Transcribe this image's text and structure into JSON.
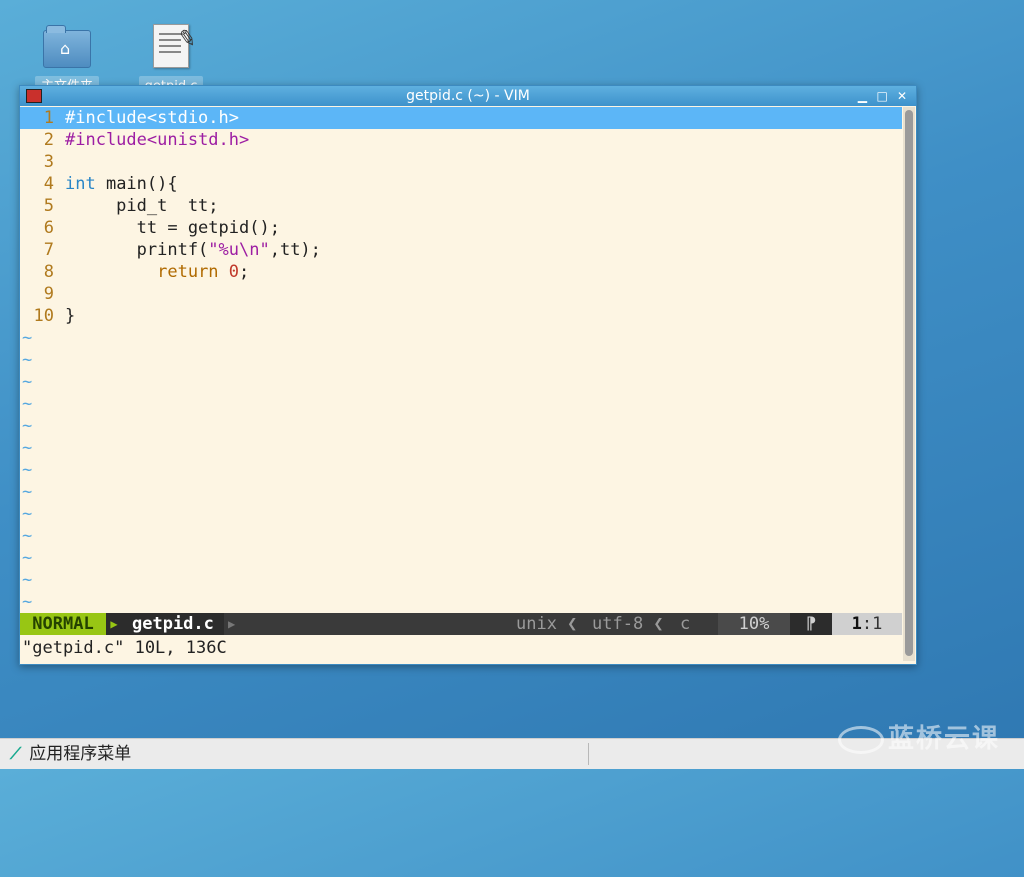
{
  "desktop": {
    "icons": [
      {
        "label": "主文件夹",
        "icon": "home-folder-icon"
      },
      {
        "label": "getpid.c",
        "icon": "text-file-icon"
      }
    ]
  },
  "window": {
    "title": "getpid.c (~) - VIM",
    "controls": {
      "minimize": "▁",
      "maximize": "□",
      "close": "✕"
    }
  },
  "editor": {
    "lines": [
      {
        "num": "1",
        "tokens": [
          {
            "t": "#include<stdio.h>",
            "c": "kw-pre"
          }
        ],
        "current": true
      },
      {
        "num": "2",
        "tokens": [
          {
            "t": "#include",
            "c": "kw-pre"
          },
          {
            "t": "<unistd.h>",
            "c": "str"
          }
        ]
      },
      {
        "num": "3",
        "tokens": []
      },
      {
        "num": "4",
        "tokens": [
          {
            "t": "int",
            "c": "kw-type"
          },
          {
            "t": " main(){",
            "c": "plain"
          }
        ]
      },
      {
        "num": "5",
        "tokens": [
          {
            "t": "     pid_t  tt;",
            "c": "plain"
          }
        ]
      },
      {
        "num": "6",
        "tokens": [
          {
            "t": "       tt = getpid();",
            "c": "plain"
          }
        ]
      },
      {
        "num": "7",
        "tokens": [
          {
            "t": "       printf(",
            "c": "plain"
          },
          {
            "t": "\"%u\\n\"",
            "c": "str"
          },
          {
            "t": ",tt);",
            "c": "plain"
          }
        ]
      },
      {
        "num": "8",
        "tokens": [
          {
            "t": "         ",
            "c": "plain"
          },
          {
            "t": "return",
            "c": "kw-ret"
          },
          {
            "t": " ",
            "c": "plain"
          },
          {
            "t": "0",
            "c": "num-lit"
          },
          {
            "t": ";",
            "c": "plain"
          }
        ]
      },
      {
        "num": "9",
        "tokens": []
      },
      {
        "num": "10",
        "tokens": [
          {
            "t": "}",
            "c": "plain"
          }
        ]
      }
    ],
    "tilde_rows": 13,
    "tilde_char": "~"
  },
  "statusline": {
    "mode": "NORMAL",
    "filename": "getpid.c",
    "fileformat": "unix ❮",
    "encoding": "utf-8 ❮",
    "filetype": "c",
    "percent": "10%",
    "mark": "⁋",
    "line": "1",
    "col": ":1"
  },
  "cmdline": "\"getpid.c\" 10L, 136C",
  "taskbar": {
    "start_label": "应用程序菜单"
  },
  "watermark": "蓝桥云课",
  "colors": {
    "current_line": "#5cb6f7",
    "mode_bg": "#98c614",
    "editor_bg": "#fdf5e3"
  }
}
